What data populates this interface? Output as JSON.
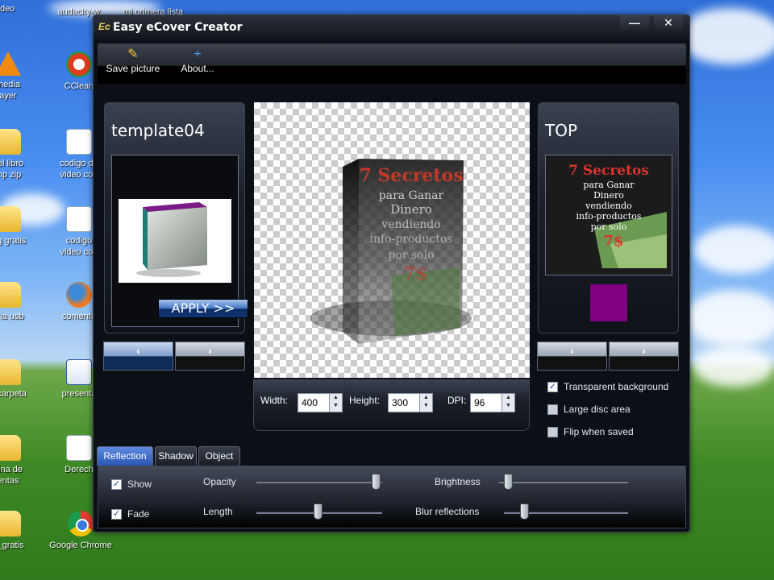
{
  "desktop": {
    "icons": [
      {
        "label": "ideo"
      },
      {
        "label": "audacity-w..."
      },
      {
        "label": "mi primera lista"
      },
      {
        "label": "media\nayer"
      },
      {
        "label": "CClean"
      },
      {
        "label": "del libro\nmp zip"
      },
      {
        "label": "codigo de\nvideo con"
      },
      {
        "label": "ing gratis"
      },
      {
        "label": "codigo\nvideo con"
      },
      {
        "label": "oria usb"
      },
      {
        "label": "comente"
      },
      {
        "label": "a carpeta"
      },
      {
        "label": "presenta"
      },
      {
        "label": "gina de\nentas"
      },
      {
        "label": "Derech"
      },
      {
        "label": "o_gratis"
      },
      {
        "label": "Google Chrome"
      }
    ]
  },
  "window": {
    "title": "Easy eCover Creator",
    "minimize": "—",
    "close": "✕"
  },
  "toolbar": {
    "save_label": "Save picture",
    "about_label": "About..."
  },
  "left_panel": {
    "title": "template04",
    "apply_label": "APPLY >>",
    "prev": "‹",
    "next": "›"
  },
  "right_panel": {
    "title": "TOP",
    "prev": "‹",
    "next": "›",
    "swatch_color": "#800080"
  },
  "book_cover": {
    "line1": "7 Secretos",
    "line2": "para Ganar",
    "line3": "Dinero",
    "line4": "vendiendo",
    "line5": "info-productos",
    "line6": "por solo",
    "price": "7$"
  },
  "size_controls": {
    "width_label": "Width:",
    "width_value": "400",
    "height_label": "Height:",
    "height_value": "300",
    "dpi_label": "DPI:",
    "dpi_value": "96"
  },
  "options": {
    "transparent_background": {
      "label": "Transparent background",
      "checked": true
    },
    "large_disc_area": {
      "label": "Large disc area",
      "checked": false
    },
    "flip_when_saved": {
      "label": "Flip when saved",
      "checked": false
    }
  },
  "tabs": [
    {
      "label": "Reflection",
      "active": true
    },
    {
      "label": "Shadow",
      "active": false
    },
    {
      "label": "Object",
      "active": false
    }
  ],
  "reflection": {
    "show": {
      "label": "Show",
      "checked": true
    },
    "fade": {
      "label": "Fade",
      "checked": true
    },
    "opacity_label": "Opacity",
    "length_label": "Length",
    "brightness_label": "Brightness",
    "blur_label": "Blur reflections"
  }
}
